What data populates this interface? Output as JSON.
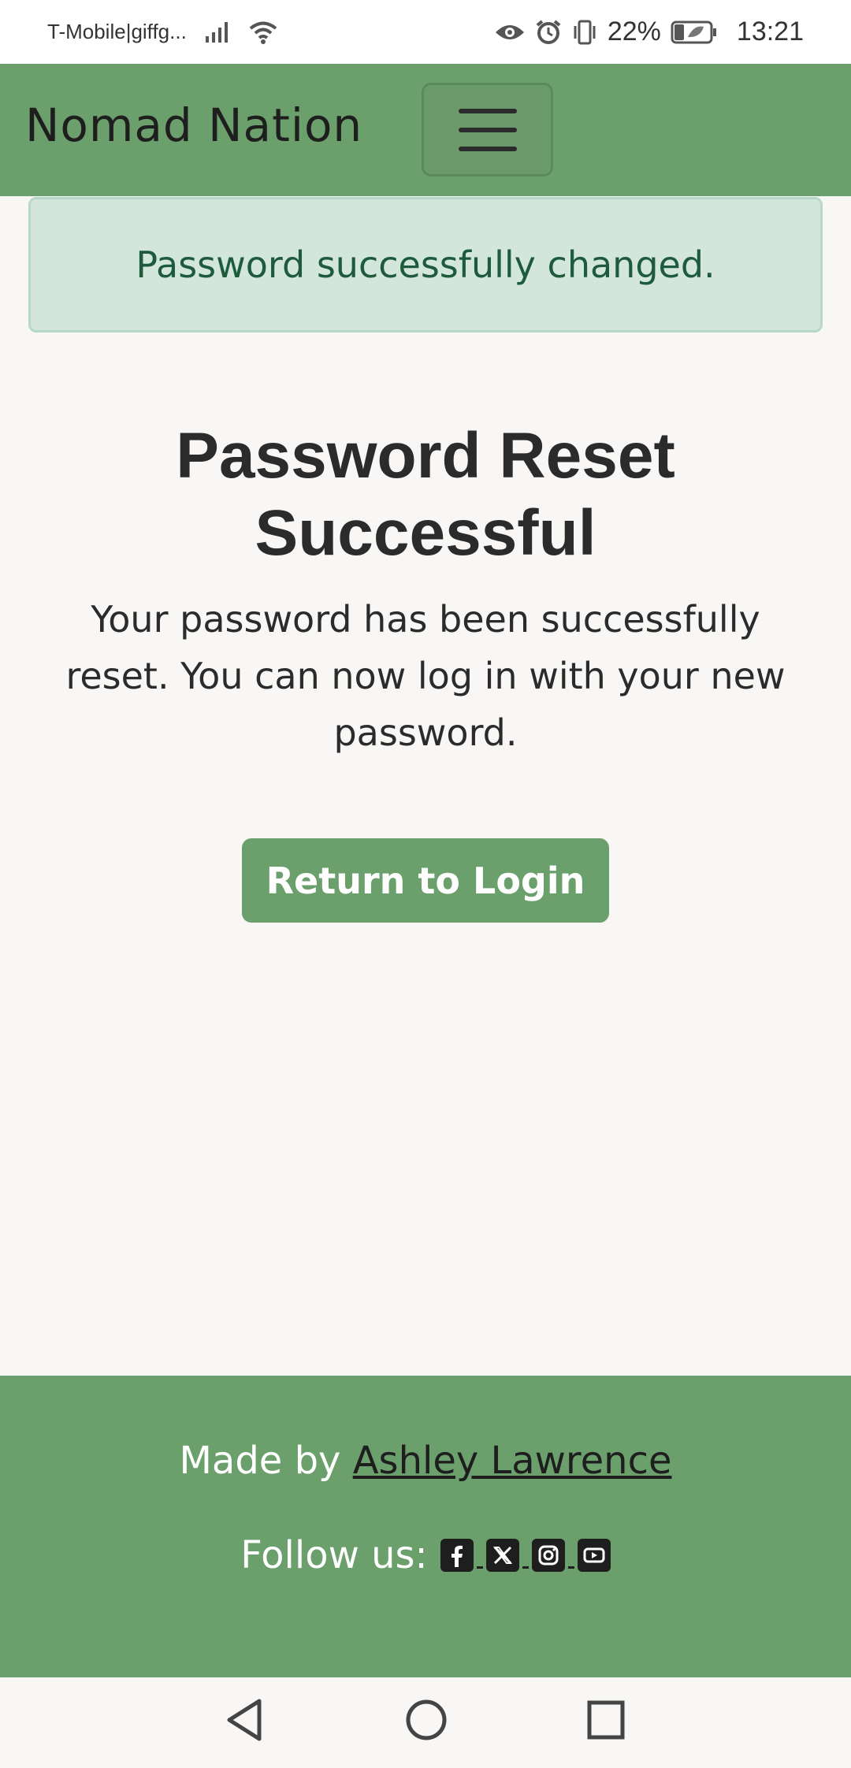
{
  "status_bar": {
    "carrier": "T-Mobile|giffg...",
    "battery": "22%",
    "time": "13:21"
  },
  "navbar": {
    "brand": "Nomad Nation",
    "toggle_icon": "hamburger-menu-icon"
  },
  "alert": {
    "message": "Password successfully changed."
  },
  "main": {
    "title_line1": "Password Reset",
    "title_line2": "Successful",
    "text_line1": "Your password has been successfully",
    "text_line2": "reset. You can now log in with your new",
    "text_line3": "password.",
    "button_label": "Return to Login"
  },
  "footer": {
    "made_by_prefix": "Made by ",
    "author": "Ashley Lawrence",
    "follow_label": "Follow us:",
    "social_icons": [
      "facebook-icon",
      "x-icon",
      "instagram-icon",
      "youtube-icon"
    ]
  },
  "colors": {
    "navbar": "#6b9f6c",
    "alert_bg": "#d2e6dc",
    "alert_text": "#1e5a3c",
    "background": "#f8f7f5"
  }
}
